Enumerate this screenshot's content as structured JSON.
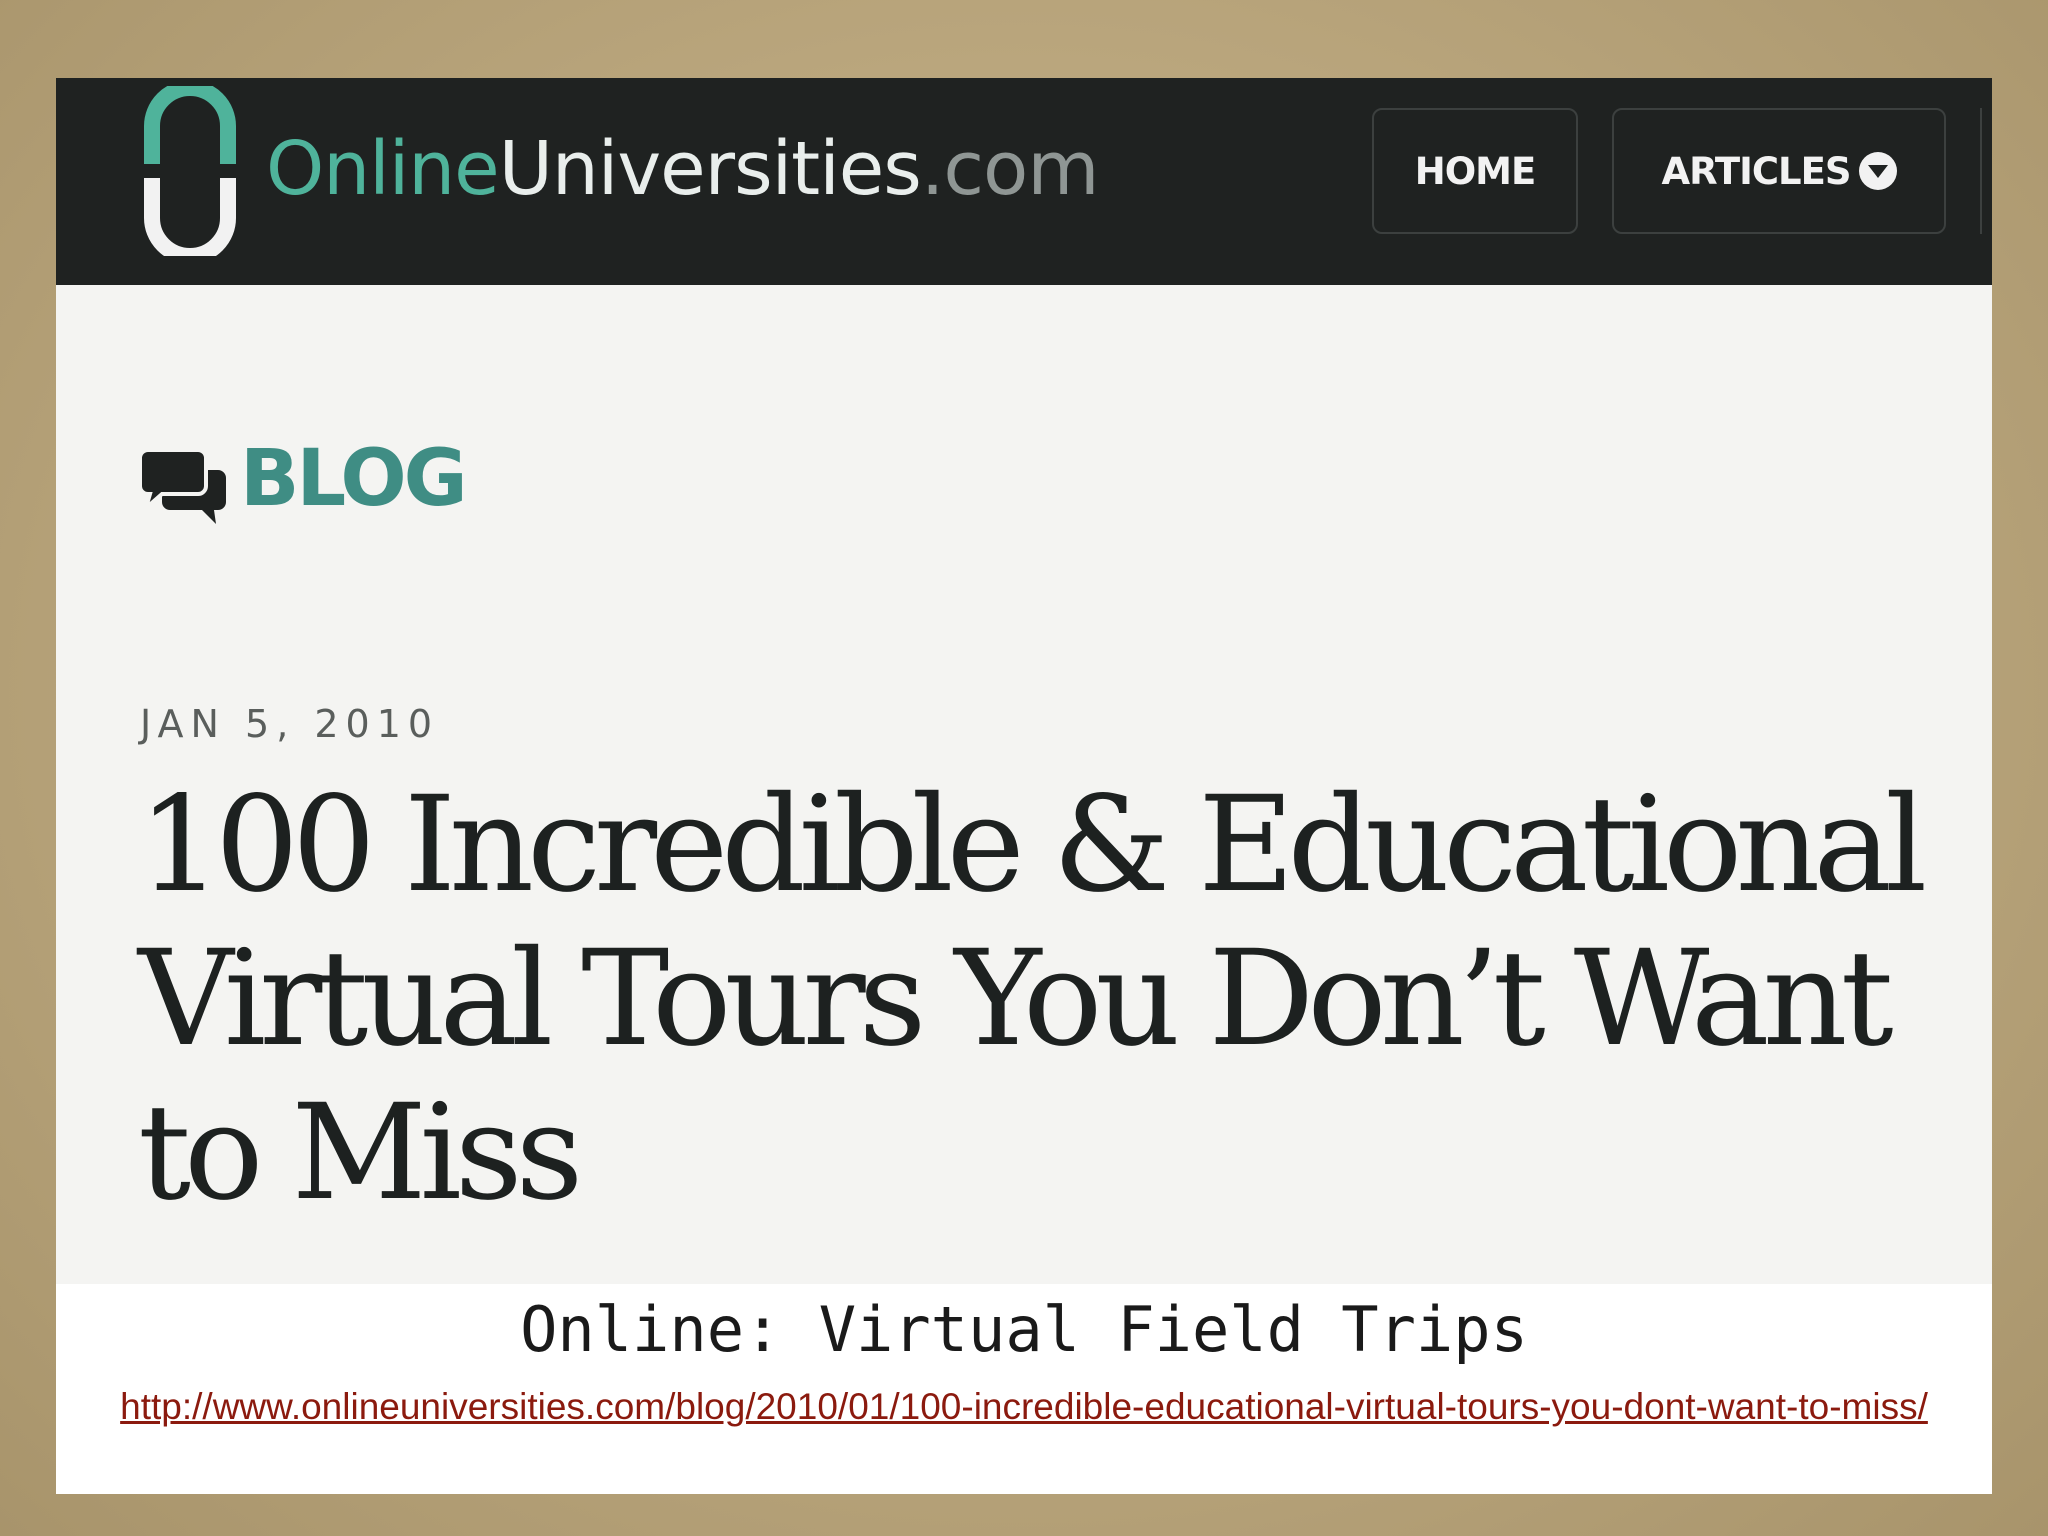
{
  "site": {
    "logo": {
      "part1": "Online",
      "part2": "Universities",
      "part3": ".com"
    },
    "nav": {
      "home": "HOME",
      "articles": "ARTICLES"
    }
  },
  "blog": {
    "label": "BLOG"
  },
  "post": {
    "date": "JAN 5, 2010",
    "title": "100 Incredible & Educational Virtual Tours You Don’t Want to Miss"
  },
  "slide": {
    "caption": "Online: Virtual Field Trips",
    "link": "http://www.onlineuniversities.com/blog/2010/01/100-incredible-educational-virtual-tours-you-dont-want-to-miss/"
  },
  "colors": {
    "accent": "#4fb39b",
    "blog": "#3f8d84",
    "navbar": "#1f2221",
    "link": "#8b1a0e"
  }
}
